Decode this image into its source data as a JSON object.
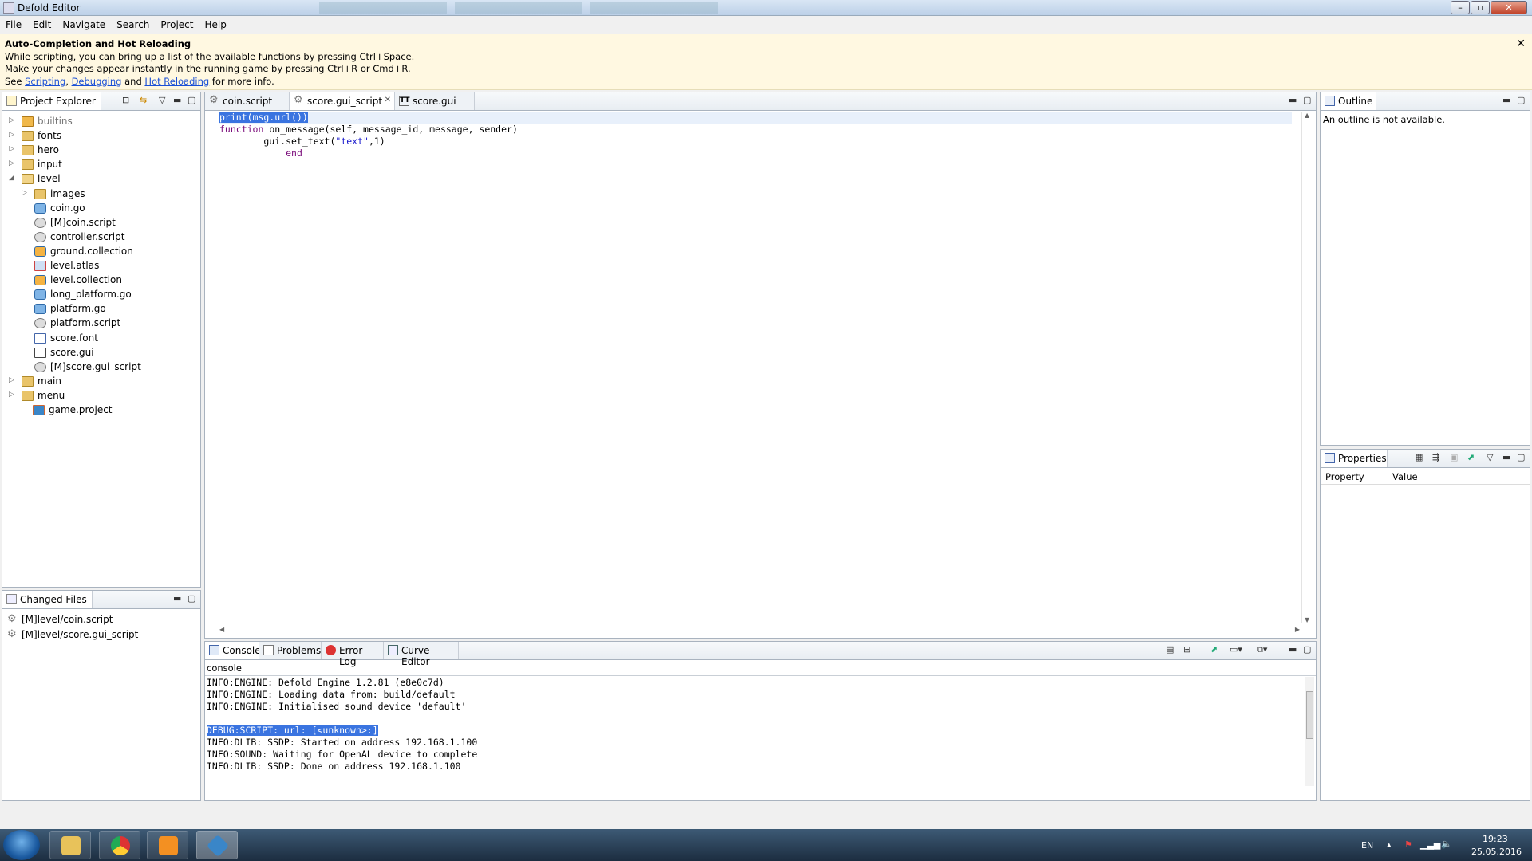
{
  "window": {
    "title": "Defold Editor"
  },
  "menu": [
    "File",
    "Edit",
    "Navigate",
    "Search",
    "Project",
    "Help"
  ],
  "banner": {
    "title": "Auto-Completion and Hot Reloading",
    "line1": "While scripting, you can bring up a list of the available functions by pressing Ctrl+Space.",
    "line2": "Make your changes appear instantly in the running game by pressing Ctrl+R or Cmd+R.",
    "line3_prefix": "See ",
    "link_scripting": "Scripting",
    "sep1": ", ",
    "link_debugging": "Debugging",
    "sep2": " and ",
    "link_hot": "Hot Reloading",
    "line3_suffix": " for more info.",
    "close": "✕"
  },
  "project_explorer": {
    "title": "Project Explorer",
    "items": [
      {
        "label": "builtins",
        "depth": 0,
        "kind": "folder-special",
        "twisty": "▷"
      },
      {
        "label": "fonts",
        "depth": 0,
        "kind": "folder",
        "twisty": "▷"
      },
      {
        "label": "hero",
        "depth": 0,
        "kind": "folder",
        "twisty": "▷"
      },
      {
        "label": "input",
        "depth": 0,
        "kind": "folder",
        "twisty": "▷"
      },
      {
        "label": "level",
        "depth": 0,
        "kind": "folder-open",
        "twisty": "◢"
      },
      {
        "label": "images",
        "depth": 1,
        "kind": "folder",
        "twisty": "▷"
      },
      {
        "label": "coin.go",
        "depth": 1,
        "kind": "go",
        "twisty": ""
      },
      {
        "label": "[M]coin.script",
        "depth": 1,
        "kind": "script",
        "twisty": ""
      },
      {
        "label": "controller.script",
        "depth": 1,
        "kind": "script",
        "twisty": ""
      },
      {
        "label": "ground.collection",
        "depth": 1,
        "kind": "collection",
        "twisty": ""
      },
      {
        "label": "level.atlas",
        "depth": 1,
        "kind": "atlas",
        "twisty": ""
      },
      {
        "label": "level.collection",
        "depth": 1,
        "kind": "collection",
        "twisty": ""
      },
      {
        "label": "long_platform.go",
        "depth": 1,
        "kind": "go",
        "twisty": ""
      },
      {
        "label": "platform.go",
        "depth": 1,
        "kind": "go",
        "twisty": ""
      },
      {
        "label": "platform.script",
        "depth": 1,
        "kind": "script",
        "twisty": ""
      },
      {
        "label": "score.font",
        "depth": 1,
        "kind": "font",
        "twisty": ""
      },
      {
        "label": "score.gui",
        "depth": 1,
        "kind": "gui",
        "twisty": ""
      },
      {
        "label": "[M]score.gui_script",
        "depth": 1,
        "kind": "script",
        "twisty": ""
      },
      {
        "label": "main",
        "depth": 0,
        "kind": "folder",
        "twisty": "▷"
      },
      {
        "label": "menu",
        "depth": 0,
        "kind": "folder",
        "twisty": "▷"
      },
      {
        "label": "game.project",
        "depth": -1,
        "kind": "project",
        "twisty": ""
      }
    ]
  },
  "changed_files": {
    "title": "Changed Files",
    "items": [
      "[M]level/coin.script",
      "[M]level/score.gui_script"
    ]
  },
  "editor": {
    "tabs": [
      {
        "label": "coin.script",
        "icon": "gear-icon"
      },
      {
        "label": "score.gui_script",
        "icon": "gear-icon"
      },
      {
        "label": "score.gui",
        "icon": "gui-icon"
      }
    ],
    "code": {
      "l1": "print(msg.url())",
      "l2_kw": "function",
      "l2_rest": " on_message(self, message_id, message, sender)",
      "l3_a": "        gui.set_text(",
      "l3_str": "\"text\"",
      "l3_b": ",1)",
      "l4_kw": "end",
      "l4_indent": "            "
    }
  },
  "console": {
    "tabs": [
      "Console",
      "Problems",
      "Error Log",
      "Curve Editor"
    ],
    "name": "console",
    "lines": [
      "INFO:ENGINE: Defold Engine 1.2.81 (e8e0c7d)",
      "INFO:ENGINE: Loading data from: build/default",
      "INFO:ENGINE: Initialised sound device 'default'",
      "",
      "DEBUG:SCRIPT: url: [<unknown>:]",
      "INFO:DLIB: SSDP: Started on address 192.168.1.100",
      "INFO:SOUND: Waiting for OpenAL device to complete",
      "INFO:DLIB: SSDP: Done on address 192.168.1.100"
    ]
  },
  "outline": {
    "title": "Outline",
    "empty": "An outline is not available."
  },
  "properties": {
    "title": "Properties",
    "col1": "Property",
    "col2": "Value"
  },
  "tray": {
    "lang": "EN",
    "time": "19:23",
    "date": "25.05.2016"
  }
}
